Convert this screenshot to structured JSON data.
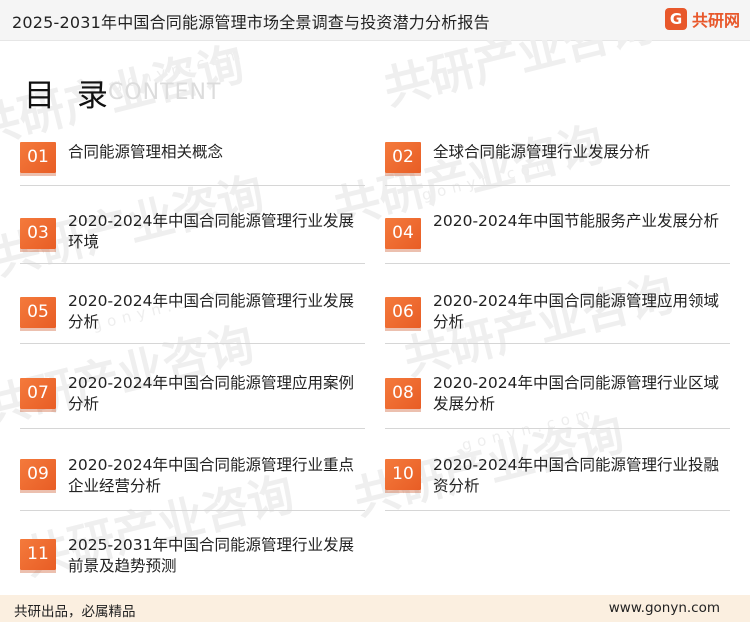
{
  "header": {
    "title": "2025-2031年中国合同能源管理市场全景调查与投资潜力分析报告",
    "logo_text": "共研网",
    "logo_mark": "G"
  },
  "watermark": {
    "text": "共研产业咨询",
    "site": "gonyn.com"
  },
  "toc": {
    "title": "目 录",
    "subtitle": "CONTENT",
    "items": [
      {
        "num": "01",
        "label": "合同能源管理相关概念"
      },
      {
        "num": "02",
        "label": "全球合同能源管理行业发展分析"
      },
      {
        "num": "03",
        "label": "2020-2024年中国合同能源管理行业发展环境"
      },
      {
        "num": "04",
        "label": "2020-2024年中国节能服务产业发展分析"
      },
      {
        "num": "05",
        "label": "2020-2024年中国合同能源管理行业发展分析"
      },
      {
        "num": "06",
        "label": "2020-2024年中国合同能源管理应用领域分析"
      },
      {
        "num": "07",
        "label": "2020-2024年中国合同能源管理应用案例分析"
      },
      {
        "num": "08",
        "label": "2020-2024年中国合同能源管理行业区域发展分析"
      },
      {
        "num": "09",
        "label": "2020-2024年中国合同能源管理行业重点企业经营分析"
      },
      {
        "num": "10",
        "label": "2020-2024年中国合同能源管理行业投融资分析"
      },
      {
        "num": "11",
        "label": "2025-2031年中国合同能源管理行业发展前景及趋势预测"
      }
    ]
  },
  "footer": {
    "slogan": "共研出品，必属精品",
    "url": "www.gonyn.com"
  }
}
